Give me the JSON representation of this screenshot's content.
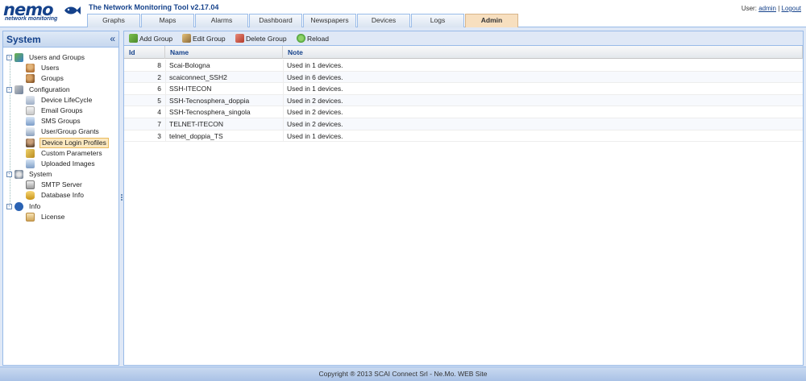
{
  "header": {
    "logo_text": "nemo",
    "logo_subtitle": "network monitoring",
    "app_title": "The Network Monitoring Tool v2.17.04",
    "user_prefix": "User:",
    "user_name": "admin",
    "separator": "|",
    "logout_label": "Logout"
  },
  "tabs": [
    {
      "label": "Graphs"
    },
    {
      "label": "Maps"
    },
    {
      "label": "Alarms"
    },
    {
      "label": "Dashboard"
    },
    {
      "label": "Newspapers"
    },
    {
      "label": "Devices"
    },
    {
      "label": "Logs"
    },
    {
      "label": "Admin",
      "active": true
    }
  ],
  "sidebar": {
    "title": "System",
    "collapse_glyph": "«",
    "tree": {
      "users_groups": {
        "label": "Users and Groups",
        "expander": "-"
      },
      "users": {
        "label": "Users"
      },
      "groups": {
        "label": "Groups"
      },
      "configuration": {
        "label": "Configuration",
        "expander": "-"
      },
      "device_lifecycle": {
        "label": "Device LifeCycle"
      },
      "email_groups": {
        "label": "Email Groups"
      },
      "sms_groups": {
        "label": "SMS Groups"
      },
      "user_group_grants": {
        "label": "User/Group Grants"
      },
      "device_login_profiles": {
        "label": "Device Login Profiles"
      },
      "custom_parameters": {
        "label": "Custom Parameters"
      },
      "uploaded_images": {
        "label": "Uploaded Images"
      },
      "system": {
        "label": "System",
        "expander": "-"
      },
      "smtp_server": {
        "label": "SMTP Server"
      },
      "database_info": {
        "label": "Database Info"
      },
      "info": {
        "label": "Info",
        "expander": "-"
      },
      "license": {
        "label": "License"
      }
    }
  },
  "toolbar": {
    "add_group": "Add Group",
    "edit_group": "Edit Group",
    "delete_group": "Delete Group",
    "reload": "Reload"
  },
  "grid": {
    "columns": {
      "id": "Id",
      "name": "Name",
      "note": "Note"
    },
    "rows": [
      {
        "id": "8",
        "name": "Scai-Bologna",
        "note": "Used in 1 devices."
      },
      {
        "id": "2",
        "name": "scaiconnect_SSH2",
        "note": "Used in 6 devices."
      },
      {
        "id": "6",
        "name": "SSH-ITECON",
        "note": "Used in 1 devices."
      },
      {
        "id": "5",
        "name": "SSH-Tecnosphera_doppia",
        "note": "Used in 2 devices."
      },
      {
        "id": "4",
        "name": "SSH-Tecnosphera_singola",
        "note": "Used in 2 devices."
      },
      {
        "id": "7",
        "name": "TELNET-ITECON",
        "note": "Used in 2 devices."
      },
      {
        "id": "3",
        "name": "telnet_doppia_TS",
        "note": "Used in 1 devices."
      }
    ]
  },
  "footer": {
    "text": "Copyright ® 2013 SCAI Connect Srl - Ne.Mo. WEB Site"
  },
  "colors": {
    "brand": "#15428b",
    "panel_border": "#99bbe8",
    "active_tab": "#f7dfbf",
    "selected_node": "#fbe8c0"
  }
}
